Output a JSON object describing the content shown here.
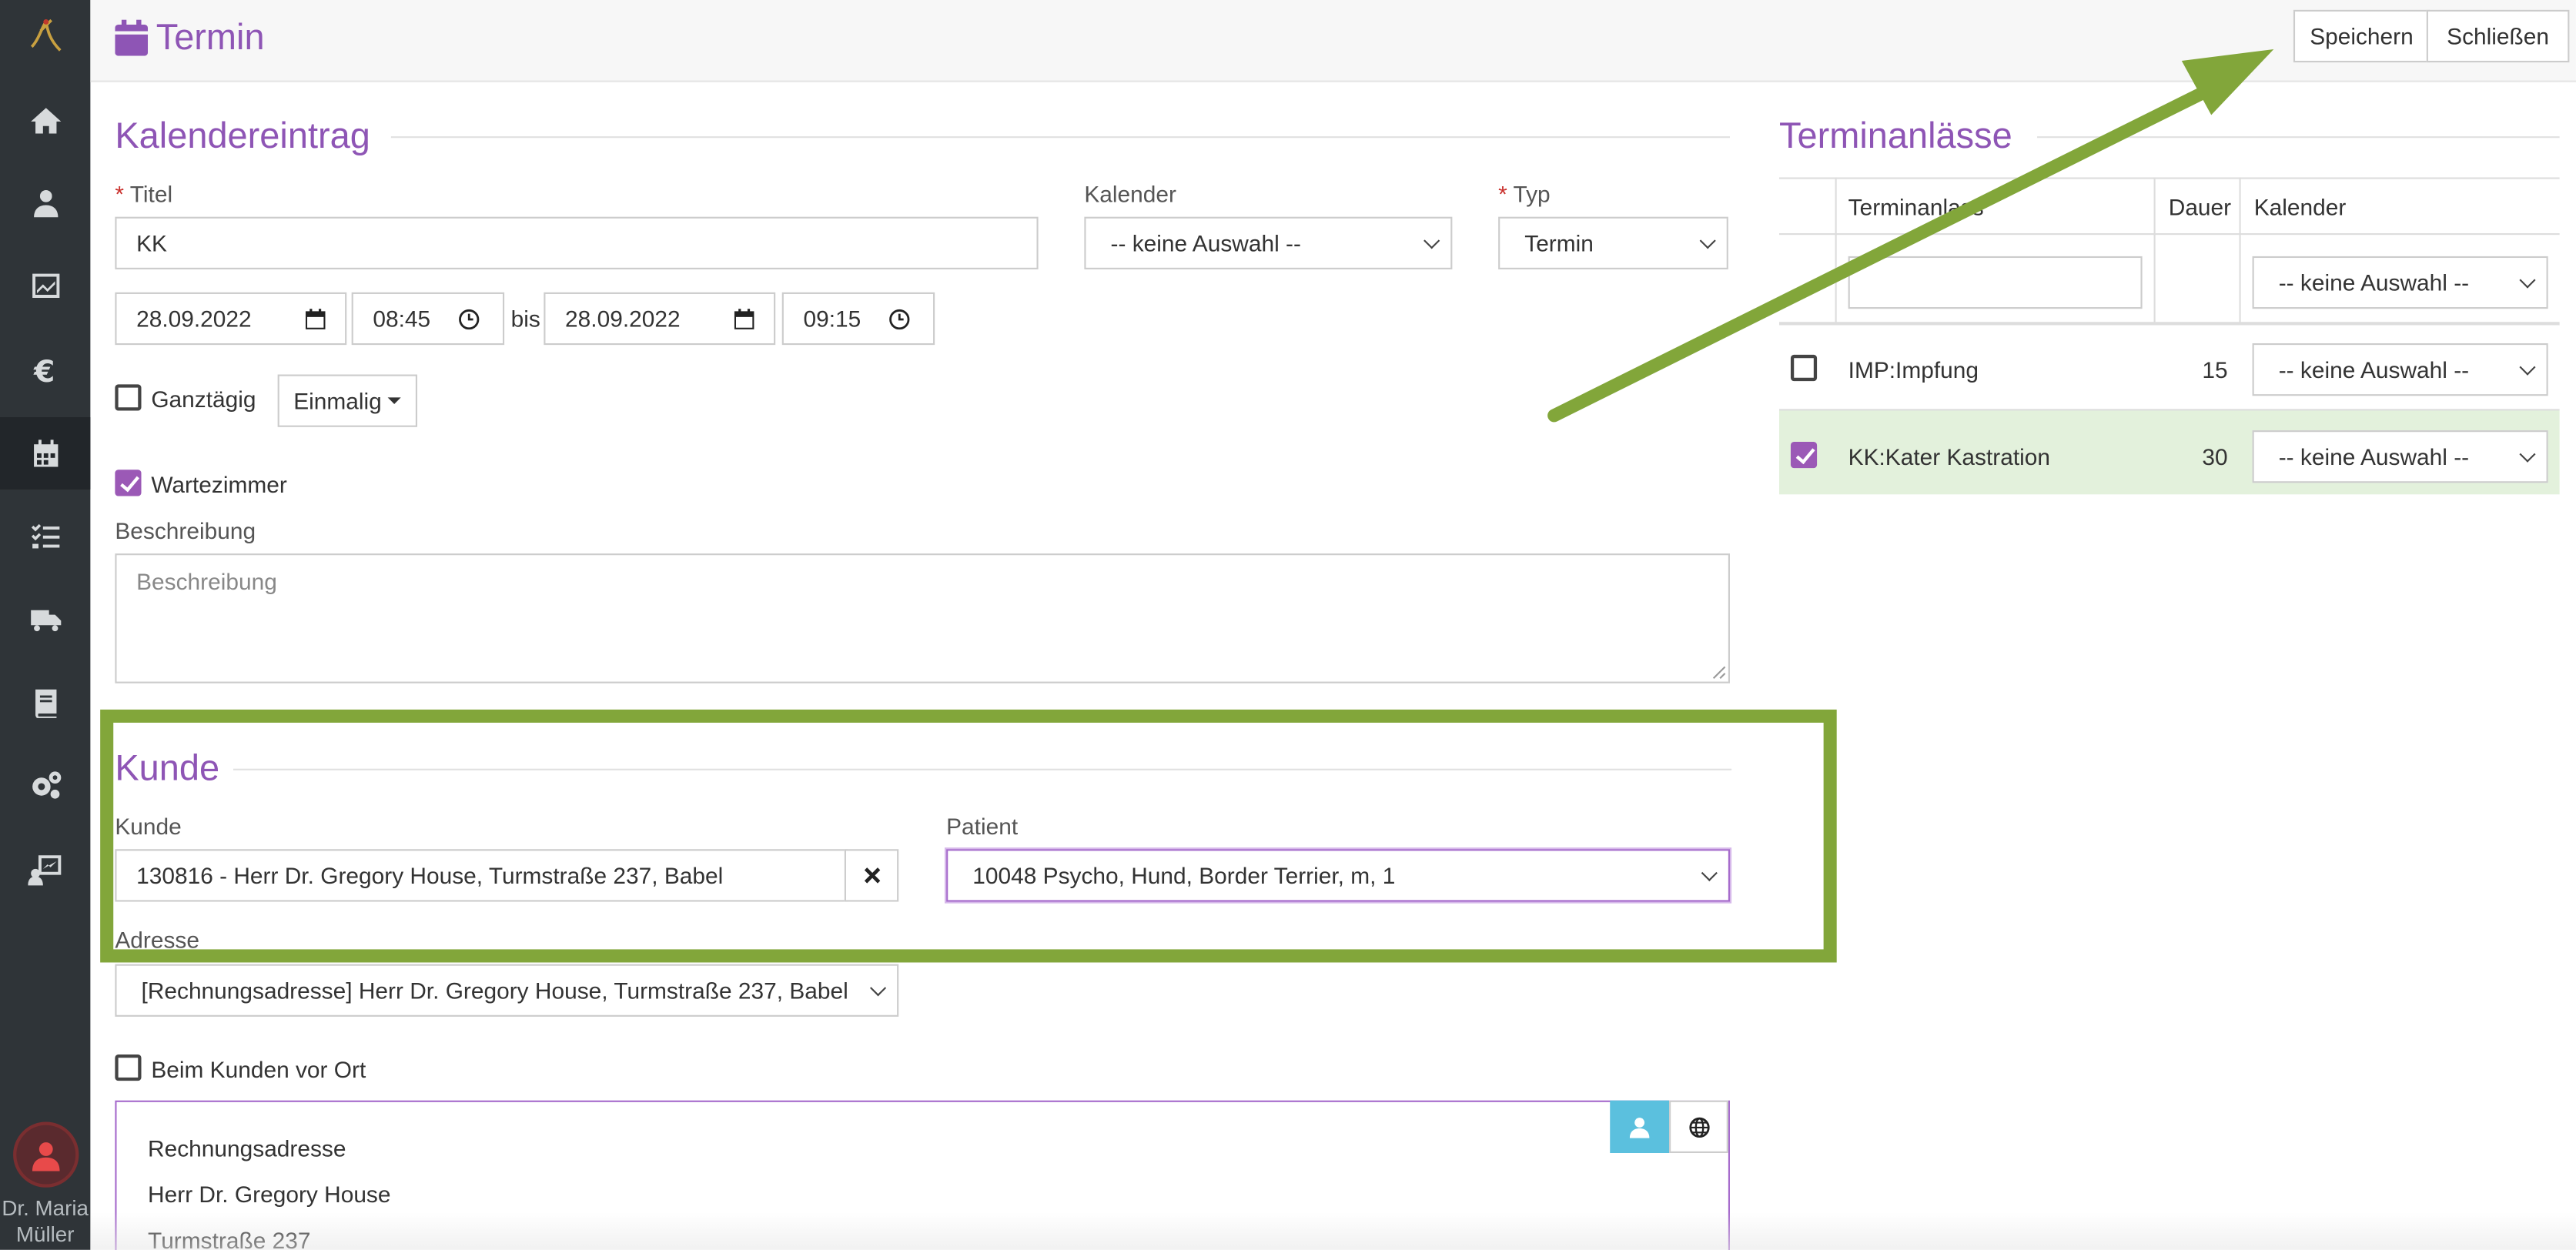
{
  "sidebar": {
    "user_name": "Dr. Maria Müller",
    "items": [
      "logo-icon",
      "home-icon",
      "user-doctor-icon",
      "chart-icon",
      "euro-icon",
      "calendar-icon",
      "tasks-icon",
      "truck-icon",
      "book-icon",
      "gears-icon",
      "analytics-icon"
    ]
  },
  "header": {
    "title": "Termin",
    "save_label": "Speichern",
    "close_label": "Schließen"
  },
  "kalendereintrag": {
    "section_title": "Kalendereintrag",
    "titel_label": "Titel",
    "titel_value": "KK",
    "kalender_label": "Kalender",
    "kalender_value": "-- keine Auswahl --",
    "typ_label": "Typ",
    "typ_value": "Termin",
    "required_mark": "*",
    "start_date": "28.09.2022",
    "start_time": "08:45",
    "bis_label": "bis",
    "end_date": "28.09.2022",
    "end_time": "09:15",
    "ganztaegig_label": "Ganztägig",
    "einmalig_label": "Einmalig",
    "wartezimmer_label": "Wartezimmer",
    "beschreibung_label": "Beschreibung",
    "beschreibung_placeholder": "Beschreibung"
  },
  "kunde": {
    "section_title": "Kunde",
    "kunde_label": "Kunde",
    "kunde_value": "130816 - Herr Dr. Gregory House, Turmstraße 237, Babel",
    "patient_label": "Patient",
    "patient_value": "10048 Psycho, Hund, Border Terrier, m, 1",
    "adresse_label": "Adresse",
    "adresse_value": "[Rechnungsadresse] Herr Dr. Gregory House, Turmstraße 237, Babel",
    "vor_ort_label": "Beim Kunden vor Ort",
    "address_lines": [
      "Rechnungsadresse",
      "Herr Dr. Gregory House",
      "Turmstraße 237"
    ]
  },
  "terminanlaesse": {
    "section_title": "Terminanlässe",
    "columns": [
      "Terminanlass",
      "Dauer",
      "Kalender"
    ],
    "filter_select": "-- keine Auswahl --",
    "rows": [
      {
        "name": "IMP:Impfung",
        "dauer": "15",
        "kalender": "-- keine Auswahl --",
        "checked": false
      },
      {
        "name": "KK:Kater Kastration",
        "dauer": "30",
        "kalender": "-- keine Auswahl --",
        "checked": true
      }
    ]
  },
  "colors": {
    "accent": "#8e55b5",
    "annotation_green": "#82a63a",
    "sidebar": "#2f3438",
    "selected_row": "#e3f1dc"
  }
}
